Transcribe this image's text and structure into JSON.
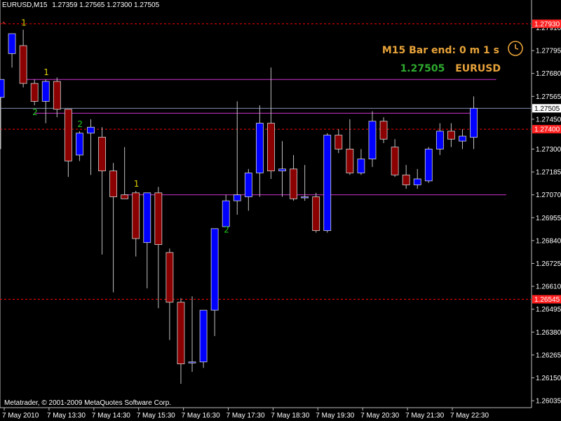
{
  "header": {
    "symbol": "EURUSD,M15",
    "ohlc": "1.27359 1.27565 1.27300 1.27505"
  },
  "overlay": {
    "timer_text": "M15 Bar end: 0 m 1 s",
    "price_text": "1.27505",
    "symbol_text": "EURUSD",
    "copyright": "Metatrader, © 2001-2009 MetaQuotes Software Corp."
  },
  "colors": {
    "background": "#000000",
    "axis": "#c0c0c0",
    "bull": "#0000ff",
    "bear": "#8b0000",
    "wick": "#c0c0c0",
    "level_line": "#ff0000",
    "pivot_line": "#cc33cc",
    "bid_line": "#7f8fb0",
    "accent_gold": "#e8a33a",
    "accent_green": "#2eaa2e",
    "fractal_1": "#e0d000",
    "fractal_2": "#22cc22"
  },
  "chart_data": {
    "type": "candlestick",
    "ylim": [
      1.26,
      1.28
    ],
    "y_ticks": [
      "1.27910",
      "1.27795",
      "1.27680",
      "1.27565",
      "1.27450",
      "1.27300",
      "1.27185",
      "1.27070",
      "1.26955",
      "1.26840",
      "1.26725",
      "1.26610",
      "1.26495",
      "1.26380",
      "1.26265",
      "1.26150",
      "1.26035"
    ],
    "x_labels": [
      "7 May 2010",
      "7 May 13:30",
      "7 May 14:30",
      "7 May 15:30",
      "7 May 16:30",
      "7 May 17:30",
      "7 May 18:30",
      "7 May 19:30",
      "7 May 20:30",
      "7 May 21:30",
      "7 May 22:30"
    ],
    "candles": [
      [
        1.2756,
        1.2761,
        1.273,
        1.2765
      ],
      [
        1.2778,
        1.2788,
        1.2771,
        1.2788
      ],
      [
        1.2782,
        1.279,
        1.2761,
        1.2763
      ],
      [
        1.2763,
        1.2765,
        1.2752,
        1.2754
      ],
      [
        1.2754,
        1.2765,
        1.2743,
        1.2764
      ],
      [
        1.2764,
        1.2766,
        1.2746,
        1.275
      ],
      [
        1.275,
        1.275,
        1.2716,
        1.2724
      ],
      [
        1.2727,
        1.2739,
        1.2724,
        1.2738
      ],
      [
        1.2738,
        1.2745,
        1.2717,
        1.2741
      ],
      [
        1.2736,
        1.2741,
        1.2677,
        1.2719
      ],
      [
        1.2719,
        1.2723,
        1.2658,
        1.2706
      ],
      [
        1.2707,
        1.2731,
        1.2705,
        1.2705
      ],
      [
        1.2708,
        1.2709,
        1.2676,
        1.2685
      ],
      [
        1.2683,
        1.269,
        1.266,
        1.2708
      ],
      [
        1.2708,
        1.2711,
        1.265,
        1.2682
      ],
      [
        1.2678,
        1.268,
        1.2634,
        1.2653
      ],
      [
        1.2653,
        1.2655,
        1.2612,
        1.2622
      ],
      [
        1.2623,
        1.2656,
        1.2618,
        1.2623
      ],
      [
        1.2623,
        1.2644,
        1.262,
        1.2649
      ],
      [
        1.2649,
        1.2652,
        1.2636,
        1.269
      ],
      [
        1.2691,
        1.2707,
        1.2693,
        1.2704
      ],
      [
        1.2704,
        1.2754,
        1.2697,
        1.2707
      ],
      [
        1.2706,
        1.272,
        1.2699,
        1.2718
      ],
      [
        1.2718,
        1.2752,
        1.2706,
        1.2743
      ],
      [
        1.2743,
        1.2771,
        1.2715,
        1.2719
      ],
      [
        1.2719,
        1.2734,
        1.2706,
        1.272
      ],
      [
        1.272,
        1.2727,
        1.2704,
        1.2705
      ],
      [
        1.2706,
        1.2722,
        1.2704,
        1.2706
      ],
      [
        1.2706,
        1.2708,
        1.2688,
        1.2689
      ],
      [
        1.2689,
        1.2738,
        1.2688,
        1.2737
      ],
      [
        1.2737,
        1.274,
        1.2728,
        1.273
      ],
      [
        1.273,
        1.2745,
        1.2717,
        1.2718
      ],
      [
        1.2718,
        1.273,
        1.2717,
        1.2725
      ],
      [
        1.2725,
        1.2749,
        1.2721,
        1.2744
      ],
      [
        1.2744,
        1.2746,
        1.2733,
        1.2735
      ],
      [
        1.2731,
        1.2735,
        1.2716,
        1.2717
      ],
      [
        1.2717,
        1.2722,
        1.271,
        1.2712
      ],
      [
        1.2712,
        1.272,
        1.271,
        1.2715
      ],
      [
        1.2714,
        1.2731,
        1.2713,
        1.273
      ],
      [
        1.273,
        1.2743,
        1.2727,
        1.2739
      ],
      [
        1.2739,
        1.2743,
        1.2731,
        1.2735
      ],
      [
        1.2734,
        1.274,
        1.273,
        1.27365
      ],
      [
        1.27359,
        1.27565,
        1.273,
        1.27505
      ]
    ],
    "horizontal_levels": [
      {
        "price": 1.2793,
        "style": "dashed",
        "color": "#ff0000",
        "label": "1.27930"
      },
      {
        "price": 1.274,
        "style": "dashed",
        "color": "#ff0000",
        "label": "1.27400"
      },
      {
        "price": 1.26545,
        "style": "dashed",
        "color": "#ff0000",
        "label": "1.26545"
      },
      {
        "price": 1.27505,
        "style": "solid",
        "color": "#7f8fb0",
        "label": "1.27505"
      }
    ],
    "pivot_segments": [
      {
        "from_index": 2,
        "to_index": 44,
        "price": 1.2765
      },
      {
        "from_index": 3,
        "to_index": 42,
        "price": 1.2748
      },
      {
        "from_index": 11,
        "to_index": 47,
        "price": 1.2707
      }
    ],
    "fractal_labels": [
      {
        "index": 2,
        "text": "1",
        "position": "above",
        "color": "#e0d000"
      },
      {
        "index": 3,
        "text": "2",
        "position": "below",
        "color": "#22cc22"
      },
      {
        "index": 4,
        "text": "1",
        "position": "above",
        "color": "#e0d000"
      },
      {
        "index": 7,
        "text": "2",
        "position": "above",
        "color": "#22cc22"
      },
      {
        "index": 12,
        "text": "1",
        "position": "above",
        "color": "#e0d000"
      },
      {
        "index": 20,
        "text": "2",
        "position": "below",
        "color": "#22cc22"
      }
    ],
    "grid": false,
    "legend": "none"
  }
}
